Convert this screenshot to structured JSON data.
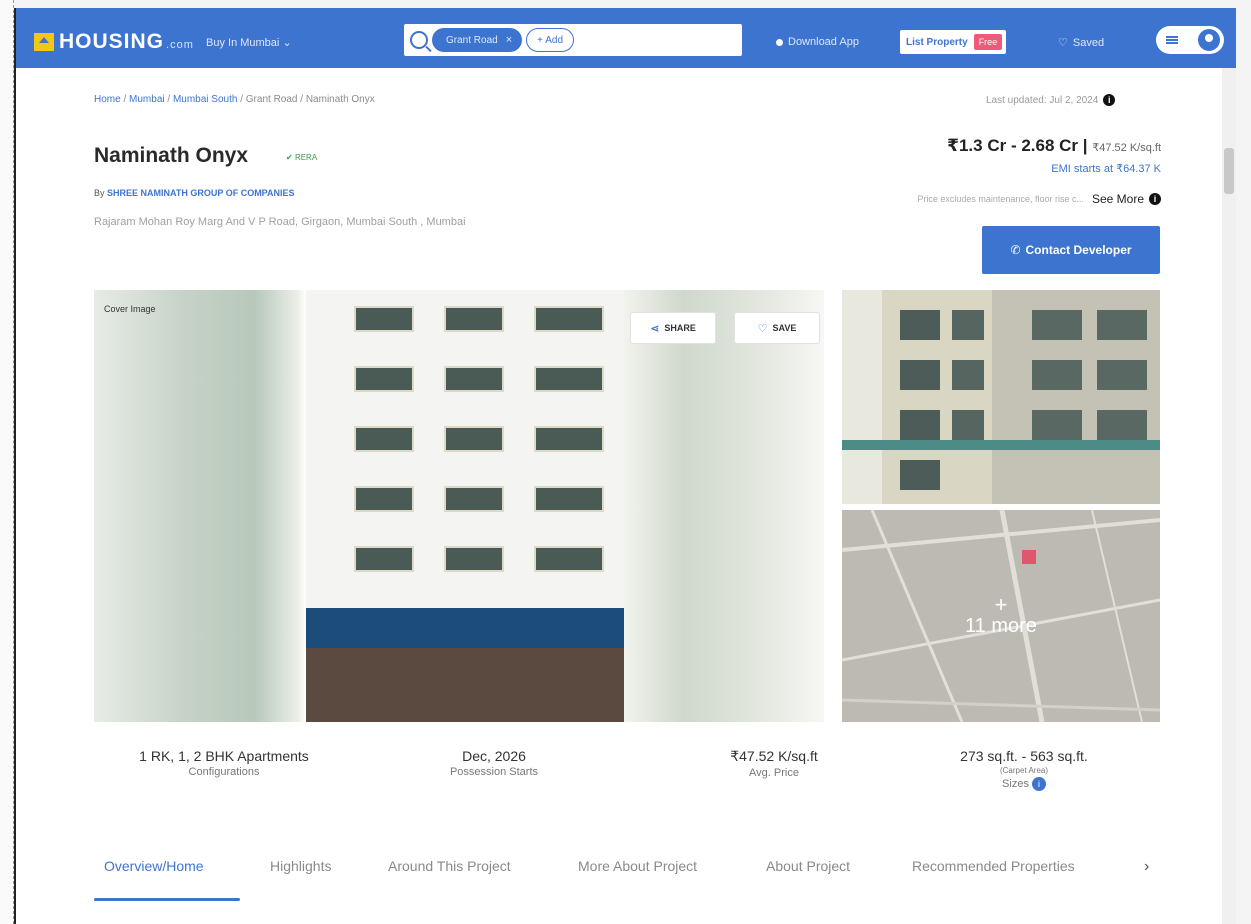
{
  "header": {
    "logo_text": "HOUSING",
    "logo_suffix": ".com",
    "buy_in_label": "Buy In Mumbai",
    "search_chip": "Grant Road",
    "add_label": "+ Add",
    "download_app": "Download App",
    "list_property": "List Property",
    "free_badge": "Free",
    "saved": "Saved"
  },
  "breadcrumb": {
    "items": [
      "Home",
      "Mumbai",
      "Mumbai South",
      "Grant Road",
      "Naminath Onyx"
    ],
    "separator": " / "
  },
  "last_updated": "Last updated: Jul 2, 2024",
  "project": {
    "title": "Naminath Onyx",
    "rera_badge": "RERA",
    "by_prefix": "By ",
    "developer": "SHREE NAMINATH GROUP OF COMPANIES",
    "address": "Rajaram Mohan Roy Marg And V P Road, Girgaon, Mumbai South , Mumbai"
  },
  "pricing": {
    "range": "₹1.3 Cr - 2.68 Cr",
    "separator": " | ",
    "per_sqft": "₹47.52 K/sq.ft",
    "emi": "EMI starts at ₹64.37 K",
    "note": "Price excludes maintenance, floor rise c...",
    "see_more": "See More",
    "contact_button": "Contact Developer"
  },
  "gallery": {
    "cover_label": "Cover Image",
    "share": "SHARE",
    "save": "SAVE",
    "more_plus": "+",
    "more_count": "11 more"
  },
  "stats": [
    {
      "value": "1 RK, 1, 2 BHK Apartments",
      "label": "Configurations"
    },
    {
      "value": "Dec, 2026",
      "label": "Possession Starts"
    },
    {
      "value": "₹47.52 K/sq.ft",
      "label": "Avg. Price"
    },
    {
      "value": "273 sq.ft. - 563 sq.ft.",
      "sub": "(Carpet Area)",
      "label": "Sizes"
    }
  ],
  "tabs": [
    {
      "label": "Overview/Home"
    },
    {
      "label": "Highlights"
    },
    {
      "label": "Around This Project"
    },
    {
      "label": "More About Project"
    },
    {
      "label": "About Project"
    },
    {
      "label": "Recommended Properties"
    }
  ],
  "tab_next": "›",
  "colors": {
    "primary": "#3d74d0",
    "free_badge": "#ef5a7a",
    "rera": "#3a9a4a"
  }
}
